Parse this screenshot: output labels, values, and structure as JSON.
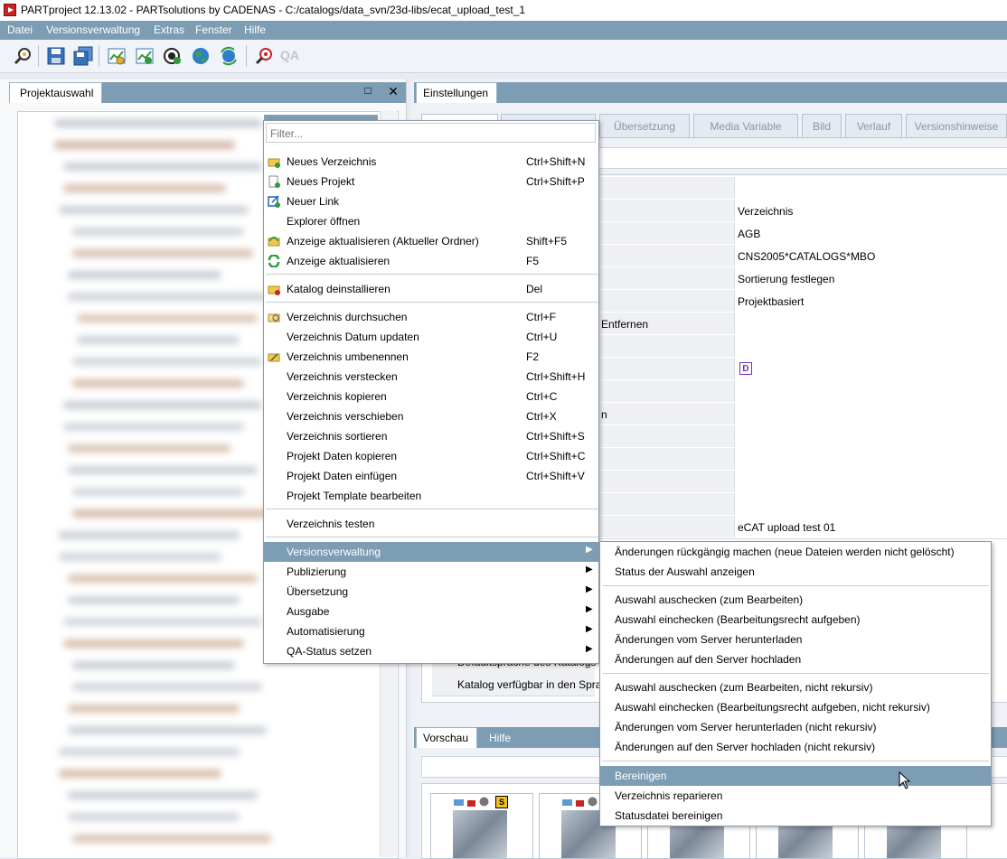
{
  "window": {
    "title": "PARTproject 12.13.02 - PARTsolutions by CADENAS - C:/catalogs/data_svn/23d-libs/ecat_upload_test_1"
  },
  "menubar": {
    "items": [
      "Datei",
      "Versionsverwaltung",
      "Extras",
      "Fenster",
      "Hilfe"
    ]
  },
  "toolbar": {
    "qa_label": "QA"
  },
  "left_panel": {
    "tab_label": "Projektauswahl",
    "maximize_glyph": "□",
    "close_glyph": "✕"
  },
  "right_panel": {
    "tab_label": "Einstellungen",
    "subtabs": [
      "",
      "",
      "Übersetzung",
      "Media Variable",
      "Bild",
      "Verlauf",
      "Versionshinweise"
    ],
    "property_values": [
      "",
      "Verzeichnis",
      "AGB",
      "CNS2005*CATALOGS*MBO",
      "Sortierung festlegen",
      "Projektbasiert",
      "",
      "",
      "",
      "",
      "",
      "",
      "",
      "",
      "",
      "eCAT upload test 01"
    ],
    "partial_labels": {
      "entfernen": "Entfernen",
      "n_suffix": "n"
    },
    "d_badge": "D",
    "lower_rows": [
      "Defaultsprache des Katalogs",
      "Katalog verfügbar in den Spra"
    ]
  },
  "preview_panel": {
    "tab_label": "Vorschau",
    "help_tab_label": "Hilfe",
    "thumb_badge": "S"
  },
  "context_menu": {
    "filter_placeholder": "Filter...",
    "items": [
      {
        "label": "Neues Verzeichnis",
        "shortcut": "Ctrl+Shift+N",
        "icon": "new-folder-icon"
      },
      {
        "label": "Neues Projekt",
        "shortcut": "Ctrl+Shift+P",
        "icon": "new-project-icon"
      },
      {
        "label": "Neuer Link",
        "shortcut": "",
        "icon": "new-link-icon"
      },
      {
        "label": "Explorer öffnen",
        "shortcut": "",
        "icon": ""
      },
      {
        "label": "Anzeige aktualisieren (Aktueller Ordner)",
        "shortcut": "Shift+F5",
        "icon": "refresh-folder-icon"
      },
      {
        "label": "Anzeige aktualisieren",
        "shortcut": "F5",
        "icon": "refresh-icon"
      },
      {
        "label": "Katalog deinstallieren",
        "shortcut": "Del",
        "icon": "uninstall-icon"
      },
      {
        "label": "Verzeichnis durchsuchen",
        "shortcut": "Ctrl+F",
        "icon": "search-folder-icon"
      },
      {
        "label": "Verzeichnis Datum updaten",
        "shortcut": "Ctrl+U",
        "icon": ""
      },
      {
        "label": "Verzeichnis umbenennen",
        "shortcut": "F2",
        "icon": "rename-folder-icon"
      },
      {
        "label": "Verzeichnis verstecken",
        "shortcut": "Ctrl+Shift+H",
        "icon": ""
      },
      {
        "label": "Verzeichnis kopieren",
        "shortcut": "Ctrl+C",
        "icon": ""
      },
      {
        "label": "Verzeichnis verschieben",
        "shortcut": "Ctrl+X",
        "icon": ""
      },
      {
        "label": "Verzeichnis sortieren",
        "shortcut": "Ctrl+Shift+S",
        "icon": ""
      },
      {
        "label": "Projekt Daten kopieren",
        "shortcut": "Ctrl+Shift+C",
        "icon": ""
      },
      {
        "label": "Projekt Daten einfügen",
        "shortcut": "Ctrl+Shift+V",
        "icon": ""
      },
      {
        "label": "Projekt Template bearbeiten",
        "shortcut": "",
        "icon": ""
      },
      {
        "label": "Verzeichnis testen",
        "shortcut": "",
        "icon": ""
      },
      {
        "label": "Versionsverwaltung",
        "shortcut": "",
        "icon": "",
        "submenu": true
      },
      {
        "label": "Publizierung",
        "shortcut": "",
        "icon": "",
        "submenu": true
      },
      {
        "label": "Übersetzung",
        "shortcut": "",
        "icon": "",
        "submenu": true
      },
      {
        "label": "Ausgabe",
        "shortcut": "",
        "icon": "",
        "submenu": true
      },
      {
        "label": "Automatisierung",
        "shortcut": "",
        "icon": "",
        "submenu": true
      },
      {
        "label": "QA-Status setzen",
        "shortcut": "",
        "icon": "",
        "submenu": true
      }
    ]
  },
  "submenu": {
    "items": [
      "Änderungen rückgängig machen (neue Dateien werden nicht gelöscht)",
      "Status der Auswahl anzeigen",
      "Auswahl auschecken (zum Bearbeiten)",
      "Auswahl einchecken (Bearbeitungsrecht aufgeben)",
      "Änderungen vom Server herunterladen",
      "Änderungen auf den Server hochladen",
      "Auswahl auschecken (zum Bearbeiten, nicht rekursiv)",
      "Auswahl einchecken (Bearbeitungsrecht aufgeben, nicht rekursiv)",
      "Änderungen vom Server herunterladen (nicht rekursiv)",
      "Änderungen auf den Server hochladen (nicht rekursiv)",
      "Bereinigen",
      "Verzeichnis reparieren",
      "Statusdatei bereinigen"
    ]
  },
  "colors": {
    "accent": "#7d9db4",
    "highlight": "#7d9db4"
  }
}
